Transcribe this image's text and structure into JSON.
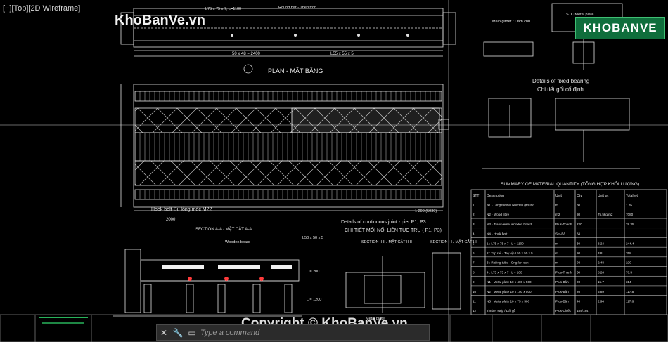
{
  "viewport": {
    "label": "[−][Top][2D Wireframe]"
  },
  "watermark": {
    "top": "KhoBanVe.vn",
    "bottom": "Copyright © KhoBanVe.vn",
    "logo": "KHOBANVE"
  },
  "command_line": {
    "placeholder": "Type a command"
  },
  "icons": {
    "close": "close-icon",
    "wrench": "wrench-icon",
    "prompt": "command-prompt-icon"
  },
  "colors": {
    "background": "#000000",
    "line": "#e6e6e6",
    "accent": "#ff3b3b",
    "green": "#29b35b"
  },
  "drawing": {
    "plan_title": "PLAN - MẶT BẰNG",
    "fixed_bearing_title_en": "Details of fixed bearing",
    "fixed_bearing_title_vi": "Chi tiết gối cố định",
    "joint_title_en": "Details of continuous joint - pier P1, P3",
    "joint_title_vi": "CHI TIẾT MỐI NỐI LIÊN TỤC TRỤ ( P1, P3)",
    "section_aa": "SECTION A-A / MẶT CẮT A-A",
    "section_ii": "SECTION II-II / MẶT CẮT II-II",
    "section_i": "SECTION I-I / MẶT CẮT I-I",
    "hook_bolt": "Hook bolt-Bu lông móc M22",
    "dim_50": "50 x 48 = 2400",
    "dim_l55": "L55 x 55 x 5",
    "dim_2000": "2000",
    "dim_1200": "1 200 (5030)",
    "round_bar": "Round bar - Thép tròn",
    "main_girder": "Main girder / Dầm chủ",
    "stc_plate": "STC Metal plate",
    "l75": "L75 x 75 x 7, L=1100",
    "l50": "L50 x 50 x 5",
    "l_200": "L = 200",
    "l_1200": "L = 1200",
    "wood_board": "Wooden board",
    "metal_plate": "Metal plate"
  },
  "material_table": {
    "title": "SUMMARY OF MATERIAL QUANTITY (TỔNG HỢP KHỐI LƯỢNG)",
    "headers": [
      "STT",
      "Description",
      "Unit",
      "Qty",
      "Unit wt",
      "Total wt"
    ],
    "rows": [
      [
        "1",
        "N1 - Longitudinal wooden ground",
        "m",
        "80",
        "",
        "1.35"
      ],
      [
        "2",
        "N2 - Wood fibre",
        "m2",
        "80",
        "75.5kg/m2",
        "7080"
      ],
      [
        "3",
        "N3 - Transversal wooden board",
        "Plus-Thanh",
        "220",
        "",
        "28.35"
      ],
      [
        "4",
        "N4 - Hook bolt",
        "Set-Bộ",
        "84",
        "",
        ""
      ],
      [
        "5",
        "1 : L75 x 75 x 7 , L = 1100",
        "m",
        "30",
        "8.24",
        "244.4"
      ],
      [
        "6",
        "2 : Top rail - Tay vịn L50 x 50 x 5",
        "m",
        "80",
        "3.8",
        "358"
      ],
      [
        "7",
        "3 : Railing tube - Ống lan can",
        "m",
        "98",
        "2.48",
        "220"
      ],
      [
        "8",
        "4 : L75 x 75 x 7 , L = 200",
        "Plus-Thanh",
        "30",
        "8.24",
        "76.3"
      ],
      [
        "9",
        "N1 : Metal plate 10 x 400 x 500",
        "Plus-Bản",
        "20",
        "15.7",
        "314"
      ],
      [
        "10",
        "N2 : Metal plate 10 x 150 x 500",
        "Plus-Bản",
        "20",
        "5.89",
        "117.8"
      ],
      [
        "11",
        "N3 : Metal plate 10 x 75 x 500",
        "Plus-Bản",
        "40",
        "2.94",
        "117.6"
      ],
      [
        "12",
        "Timber strip / Dải gỗ",
        "Plus-Chiếc",
        "184/184",
        "",
        ""
      ]
    ]
  }
}
